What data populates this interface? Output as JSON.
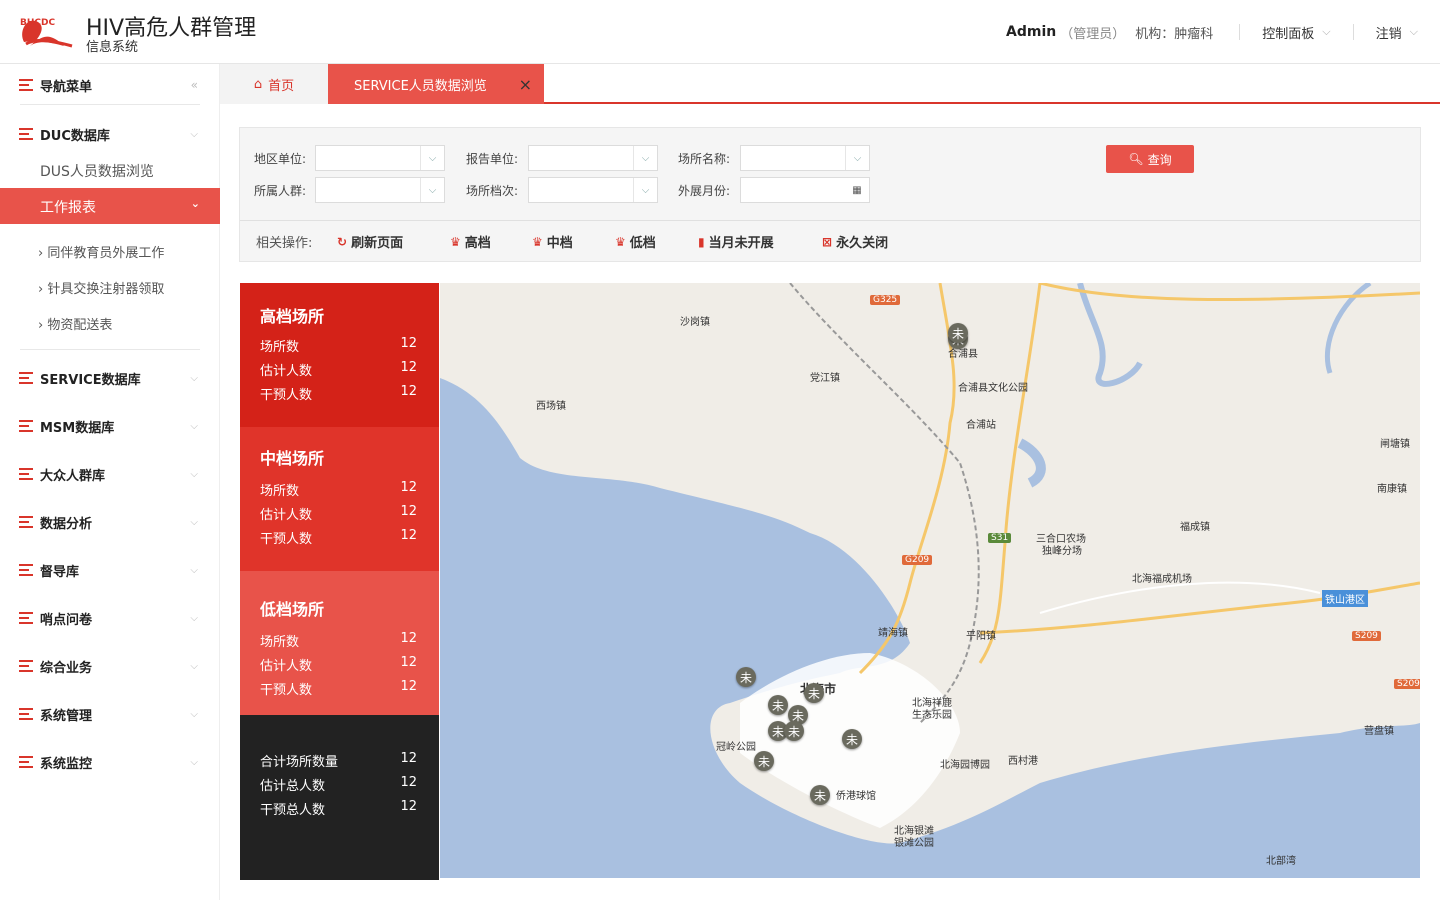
{
  "header": {
    "logo_text": "BHCDC",
    "title": "HIV高危人群管理",
    "subtitle": "信息系统",
    "user": "Admin",
    "role": "（管理员）",
    "org": "机构：肿瘤科",
    "dashboard": "控制面板",
    "logout": "注销"
  },
  "sidebar": {
    "nav_menu": "导航菜单",
    "duc": "DUC数据库",
    "dus": "DUS人员数据浏览",
    "work_report": "工作报表",
    "sub_items": [
      "同伴教育员外展工作",
      "针具交换注射器领取",
      "物资配送表"
    ],
    "groups": [
      "SERVICE数据库",
      "MSM数据库",
      "大众人群库",
      "数据分析",
      "督导库",
      "哨点问卷",
      "综合业务",
      "系统管理",
      "系统监控"
    ]
  },
  "tabs": {
    "home": "首页",
    "active": "SERVICE人员数据浏览",
    "close": "×"
  },
  "filters": {
    "region": "地区单位:",
    "report_unit": "报告单位:",
    "venue_name": "场所名称:",
    "population": "所属人群:",
    "venue_grade": "场所档次:",
    "month": "外展月份:",
    "query": "查询",
    "ops_label": "相关操作:",
    "ops": [
      "刷新页面",
      "高档",
      "中档",
      "低档",
      "当月未开展",
      "永久关闭"
    ]
  },
  "stats": {
    "high": {
      "title": "高档场所",
      "venues_label": "场所数",
      "venues": "12",
      "est_label": "估计人数",
      "est": "12",
      "int_label": "干预人数",
      "int": "12"
    },
    "mid": {
      "title": "中档场所",
      "venues_label": "场所数",
      "venues": "12",
      "est_label": "估计人数",
      "est": "12",
      "int_label": "干预人数",
      "int": "12"
    },
    "low": {
      "title": "低档场所",
      "venues_label": "场所数",
      "venues": "12",
      "est_label": "估计人数",
      "est": "12",
      "int_label": "干预人数",
      "int": "12"
    },
    "total": {
      "venues_label": "合计场所数量",
      "venues": "12",
      "est_label": "估计总人数",
      "est": "12",
      "int_label": "干预总人数",
      "int": "12"
    }
  },
  "map": {
    "labels": [
      "沙岗镇",
      "合浦县",
      "党江镇",
      "西场镇",
      "合浦县文化公园",
      "合浦站",
      "三合口农场",
      "独峰分场",
      "福成镇",
      "北海福成机场",
      "南康镇",
      "铁山港区",
      "营盘镇",
      "靖海镇",
      "平阳镇",
      "北海市",
      "北海祥鹿",
      "生态乐园",
      "冠岭公园",
      "北海园博园",
      "西村港",
      "侨港球馆",
      "北海银滩",
      "银滩公园",
      "北部湾",
      "闸塘镇"
    ],
    "shields": [
      "G325",
      "G209",
      "S31",
      "S209",
      "S209"
    ],
    "marker": "未"
  },
  "colors": {
    "accent": "#d9352b",
    "high": "#d42218",
    "mid": "#e0342a",
    "low": "#e8534a",
    "total": "#222222",
    "sea": "#a9c0e0"
  }
}
